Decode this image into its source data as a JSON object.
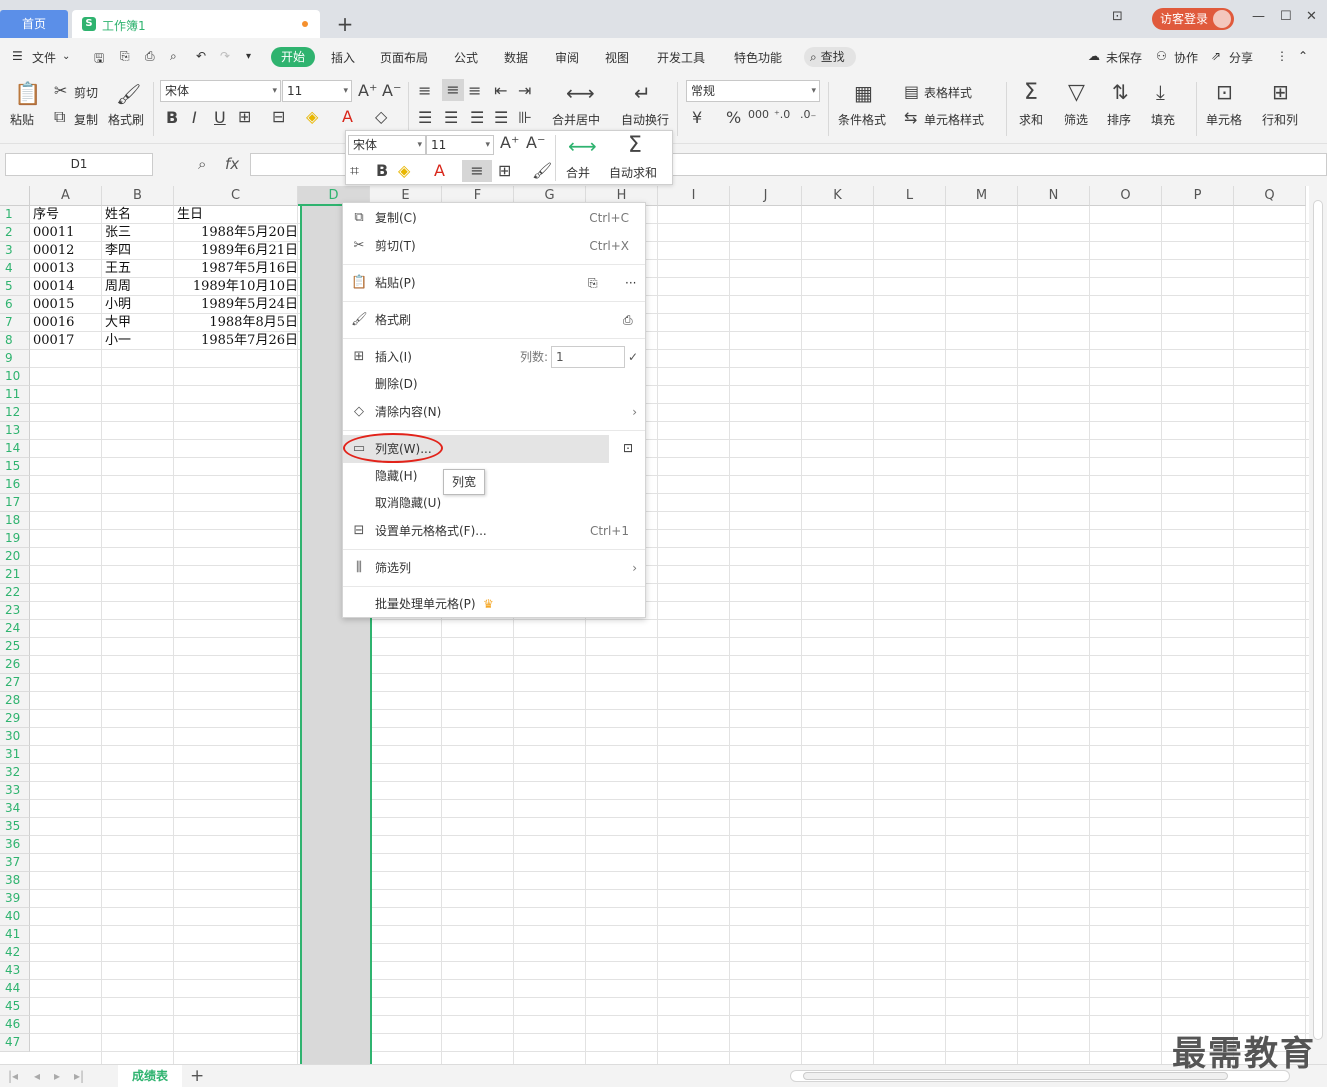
{
  "tabs": {
    "home": "首页",
    "document": "工作簿1",
    "add": "+"
  },
  "titlebar": {
    "login": "访客登录"
  },
  "menubar": {
    "file": "文件",
    "items": [
      "开始",
      "插入",
      "页面布局",
      "公式",
      "数据",
      "审阅",
      "视图",
      "开发工具",
      "特色功能"
    ],
    "search": "查找",
    "unsaved": "未保存",
    "collab": "协作",
    "share": "分享"
  },
  "ribbon": {
    "paste": "粘贴",
    "cut": "剪切",
    "copy": "复制",
    "format_painter": "格式刷",
    "font": "宋体",
    "font_size": "11",
    "merge_center": "合并居中",
    "wrap": "自动换行",
    "number_format": "常规",
    "cond_format": "条件格式",
    "table_style": "表格样式",
    "cell_style": "单元格样式",
    "sum": "求和",
    "filter": "筛选",
    "sort": "排序",
    "fill": "填充",
    "cell": "单元格",
    "rows_cols": "行和列"
  },
  "formula": {
    "namebox": "D1",
    "fx": "fx"
  },
  "mini_toolbar": {
    "font": "宋体",
    "size": "11",
    "merge": "合并",
    "autosum": "自动求和"
  },
  "columns": [
    "A",
    "B",
    "C",
    "D",
    "E",
    "F",
    "G",
    "H",
    "I",
    "J",
    "K",
    "L",
    "M",
    "N",
    "O",
    "P",
    "Q"
  ],
  "rows": [
    "1",
    "2",
    "3",
    "4",
    "5",
    "6",
    "7",
    "8",
    "9",
    "10",
    "11",
    "12",
    "13",
    "14",
    "15",
    "16",
    "17",
    "18",
    "19",
    "20",
    "21",
    "22",
    "23",
    "24",
    "25",
    "26",
    "27",
    "28",
    "29",
    "30",
    "31",
    "32",
    "33",
    "34",
    "35",
    "36",
    "37",
    "38",
    "39",
    "40",
    "41",
    "42",
    "43",
    "44",
    "45",
    "46",
    "47"
  ],
  "table": {
    "headers": [
      "序号",
      "姓名",
      "生日"
    ],
    "rows": [
      [
        "00011",
        "张三",
        "1988年5月20日"
      ],
      [
        "00012",
        "李四",
        "1989年6月21日"
      ],
      [
        "00013",
        "王五",
        "1987年5月16日"
      ],
      [
        "00014",
        "周周",
        "1989年10月10日"
      ],
      [
        "00015",
        "小明",
        "1989年5月24日"
      ],
      [
        "00016",
        "大甲",
        "1988年8月5日"
      ],
      [
        "00017",
        "小一",
        "1985年7月26日"
      ]
    ]
  },
  "context_menu": {
    "copy": "复制(C)",
    "copy_sc": "Ctrl+C",
    "cut": "剪切(T)",
    "cut_sc": "Ctrl+X",
    "paste": "粘贴(P)",
    "format_painter": "格式刷",
    "insert": "插入(I)",
    "cols_label": "列数:",
    "cols_value": "1",
    "delete": "删除(D)",
    "clear": "清除内容(N)",
    "col_width": "列宽(W)...",
    "hide": "隐藏(H)",
    "unhide": "取消隐藏(U)",
    "format_cells": "设置单元格格式(F)...",
    "format_sc": "Ctrl+1",
    "filter_col": "筛选列",
    "batch": "批量处理单元格(P)"
  },
  "tooltip": "列宽",
  "sheet": {
    "name": "成绩表",
    "add": "+"
  },
  "watermark": "最需教育",
  "colors": {
    "accent": "#2fb36f",
    "selection": "#d9d9d9",
    "highlight": "#e2231a"
  }
}
